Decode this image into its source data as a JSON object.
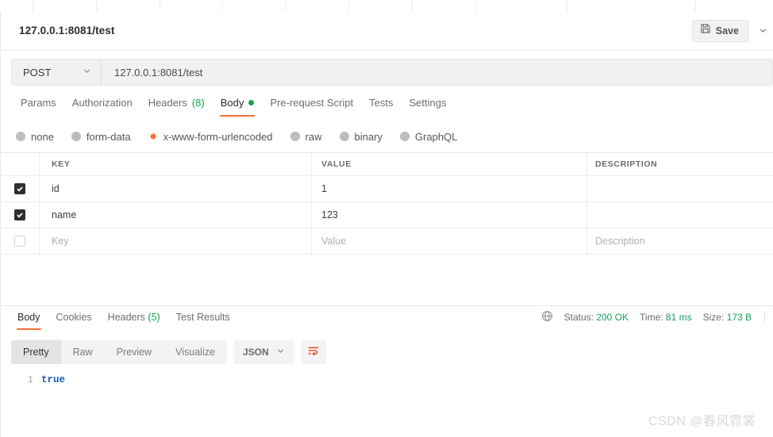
{
  "window": {
    "tab_strip_slot_count": 9
  },
  "request": {
    "title": "127.0.0.1:8081/test",
    "method": "POST",
    "url": "127.0.0.1:8081/test",
    "save_label": "Save",
    "save_icon": "floppy-disk-icon",
    "save_chevron_icon": "chevron-down-icon",
    "method_chevron_icon": "chevron-down-icon",
    "tabs": [
      {
        "label": "Params",
        "count": "",
        "active": false,
        "dot": false
      },
      {
        "label": "Authorization",
        "count": "",
        "active": false,
        "dot": false
      },
      {
        "label": "Headers",
        "count": "(8)",
        "active": false,
        "dot": false
      },
      {
        "label": "Body",
        "count": "",
        "active": true,
        "dot": true
      },
      {
        "label": "Pre-request Script",
        "count": "",
        "active": false,
        "dot": false
      },
      {
        "label": "Tests",
        "count": "",
        "active": false,
        "dot": false
      },
      {
        "label": "Settings",
        "count": "",
        "active": false,
        "dot": false
      }
    ],
    "body_types": [
      {
        "label": "none",
        "selected": false
      },
      {
        "label": "form-data",
        "selected": false
      },
      {
        "label": "x-www-form-urlencoded",
        "selected": true
      },
      {
        "label": "raw",
        "selected": false
      },
      {
        "label": "binary",
        "selected": false
      },
      {
        "label": "GraphQL",
        "selected": false
      }
    ]
  },
  "params_table": {
    "headers": {
      "key": "KEY",
      "value": "VALUE",
      "description": "DESCRIPTION"
    },
    "rows": [
      {
        "checked": true,
        "key": "id",
        "value": "1",
        "description": ""
      },
      {
        "checked": true,
        "key": "name",
        "value": "123",
        "description": ""
      }
    ],
    "placeholder_row": {
      "checked": false,
      "key": "Key",
      "value": "Value",
      "description": "Description"
    }
  },
  "response": {
    "tabs": [
      {
        "label": "Body",
        "count": "",
        "active": true
      },
      {
        "label": "Cookies",
        "count": "",
        "active": false
      },
      {
        "label": "Headers",
        "count": "(5)",
        "active": false
      },
      {
        "label": "Test Results",
        "count": "",
        "active": false
      }
    ],
    "globe_icon": "globe-icon",
    "status_label": "Status:",
    "status_value": "200 OK",
    "time_label": "Time:",
    "time_value": "81 ms",
    "size_label": "Size:",
    "size_value": "173 B",
    "view_modes": [
      {
        "label": "Pretty",
        "active": true
      },
      {
        "label": "Raw",
        "active": false
      },
      {
        "label": "Preview",
        "active": false
      },
      {
        "label": "Visualize",
        "active": false
      }
    ],
    "format": "JSON",
    "format_chevron_icon": "chevron-down-icon",
    "wrap_icon": "wrap-text-icon",
    "body_lines": [
      {
        "number": "1",
        "text": "true"
      }
    ]
  },
  "watermark": {
    "text": "CSDN @春风霓裳"
  },
  "colors": {
    "accent": "#ff6c37",
    "success": "#15a05a",
    "code_blue": "#1a5fb4",
    "checkbox": "#2f2f2f"
  }
}
